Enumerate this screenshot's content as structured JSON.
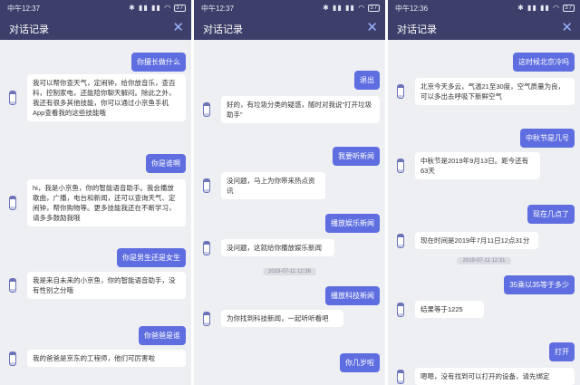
{
  "panels": [
    {
      "status_time": "中午12:37",
      "status_icons": "✱ ▮▮ ▮▮ ◠",
      "battery": "37",
      "title": "对话记录",
      "messages": [
        {
          "role": "user",
          "text": "你擅长做什么"
        },
        {
          "role": "bot",
          "text": "我可以帮你查天气，定闹钟，给你放音乐，查百科，控制家电，还能陪你聊天解闷。除此之外，我还有很多其他技能，你可以通过小京鱼手机App查看我的这些技能哦"
        },
        {
          "role": "user",
          "text": "你是谁啊"
        },
        {
          "role": "bot",
          "text": "hi，我是小京鱼，你的智能语音助手。我会播放歌曲，广播，电台和新闻，还可以查询天气、定闹钟，帮你购物等。更多技能我还在不断学习，请多多鼓励我哦"
        },
        {
          "role": "user",
          "text": "你是男生还是女生"
        },
        {
          "role": "bot",
          "text": "我是来自未来的小京鱼，你的智能语音助手，没有性别之分哦"
        },
        {
          "role": "user",
          "text": "你爸爸是谁"
        },
        {
          "role": "bot",
          "text": "我的爸爸是京东的工程师，他们可厉害啦"
        }
      ]
    },
    {
      "status_time": "中午12:37",
      "status_icons": "✱ ▮▮ ▮▮ ◠",
      "battery": "37",
      "title": "对话记录",
      "messages": [
        {
          "role": "user",
          "text": "退出"
        },
        {
          "role": "bot",
          "text": "好的，有垃圾分类的疑惑，随时对我说\"打开垃圾助手\""
        },
        {
          "role": "user",
          "text": "我要听新闻"
        },
        {
          "role": "bot",
          "text": "没问题，马上为你带来热点资讯"
        },
        {
          "role": "user",
          "text": "播放娱乐新闻"
        },
        {
          "role": "bot",
          "text": "没问题，这就给你播放娱乐新闻"
        },
        {
          "role": "timestamp",
          "text": "2019-07-11 12:36"
        },
        {
          "role": "user",
          "text": "播放科技新闻"
        },
        {
          "role": "bot",
          "text": "为你找到科技新闻，一起听听看吧"
        },
        {
          "role": "user",
          "text": "你几岁啦"
        }
      ]
    },
    {
      "status_time": "中午12:36",
      "status_icons": "✱ ▮▮ ▮▮ ◠",
      "battery": "37",
      "title": "对话记录",
      "messages": [
        {
          "role": "user",
          "text": "这时候北京冷吗"
        },
        {
          "role": "bot",
          "text": "北京今天多云，气温21至30度，空气质量为良，可以多出去呼吸下新鲜空气"
        },
        {
          "role": "user",
          "text": "中秋节是几号"
        },
        {
          "role": "bot",
          "text": "中秋节是2019年9月13日。距今还有63天"
        },
        {
          "role": "user",
          "text": "现在几点了"
        },
        {
          "role": "bot",
          "text": "现在时间是2019年7月11日12点31分"
        },
        {
          "role": "timestamp",
          "text": "2019-07-11 12:31"
        },
        {
          "role": "user",
          "text": "35乘以35等于多少"
        },
        {
          "role": "bot",
          "text": "结果等于1225"
        },
        {
          "role": "user",
          "text": "打开"
        },
        {
          "role": "bot",
          "text": "嗯嗯，没有找到可以打开的设备，请先绑定"
        }
      ]
    }
  ]
}
